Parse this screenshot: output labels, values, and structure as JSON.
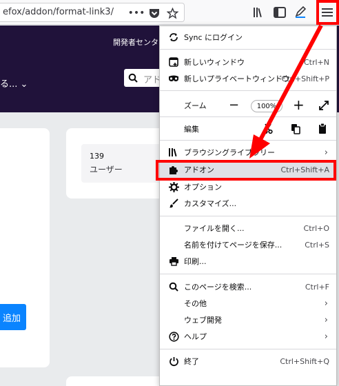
{
  "browser": {
    "url": "efox/addon/format-link3/",
    "icons": [
      "more-icon",
      "pocket-icon",
      "bookmark-star-icon",
      "library-icon",
      "sidebar-icon",
      "edit-icon",
      "hamburger-menu-icon"
    ]
  },
  "page": {
    "header_link": "開発者センタ",
    "browse_label": "る...",
    "search_placeholder": "アド",
    "stat_number": "139",
    "stat_label": "ユーザー",
    "add_button": "追加"
  },
  "menu": {
    "sync": "Sync にログイン",
    "new_window": {
      "label": "新しいウィンドウ",
      "shortcut": "Ctrl+N"
    },
    "private_window": {
      "label": "新しいプライベートウィンドウ",
      "shortcut": "Ctrl+Shift+P"
    },
    "zoom": {
      "label": "ズーム",
      "minus": "−",
      "value": "100%",
      "plus": "+"
    },
    "edit": "編集",
    "library": "ブラウジングライブラリー",
    "addons": {
      "label": "アドオン",
      "shortcut": "Ctrl+Shift+A"
    },
    "options": "オプション",
    "customize": "カスタマイズ...",
    "open_file": {
      "label": "ファイルを開く...",
      "shortcut": "Ctrl+O"
    },
    "save_page": {
      "label": "名前を付けてページを保存...",
      "shortcut": "Ctrl+S"
    },
    "print": "印刷...",
    "find": {
      "label": "このページを検索...",
      "shortcut": "Ctrl+F"
    },
    "more": "その他",
    "web_dev": "ウェブ開発",
    "help": "ヘルプ",
    "quit": {
      "label": "終了",
      "shortcut": "Ctrl+Shift+Q"
    }
  },
  "colors": {
    "accent_red": "#ff0000",
    "hero_bg": "#20123a",
    "highlight": "#e0e0e6"
  }
}
